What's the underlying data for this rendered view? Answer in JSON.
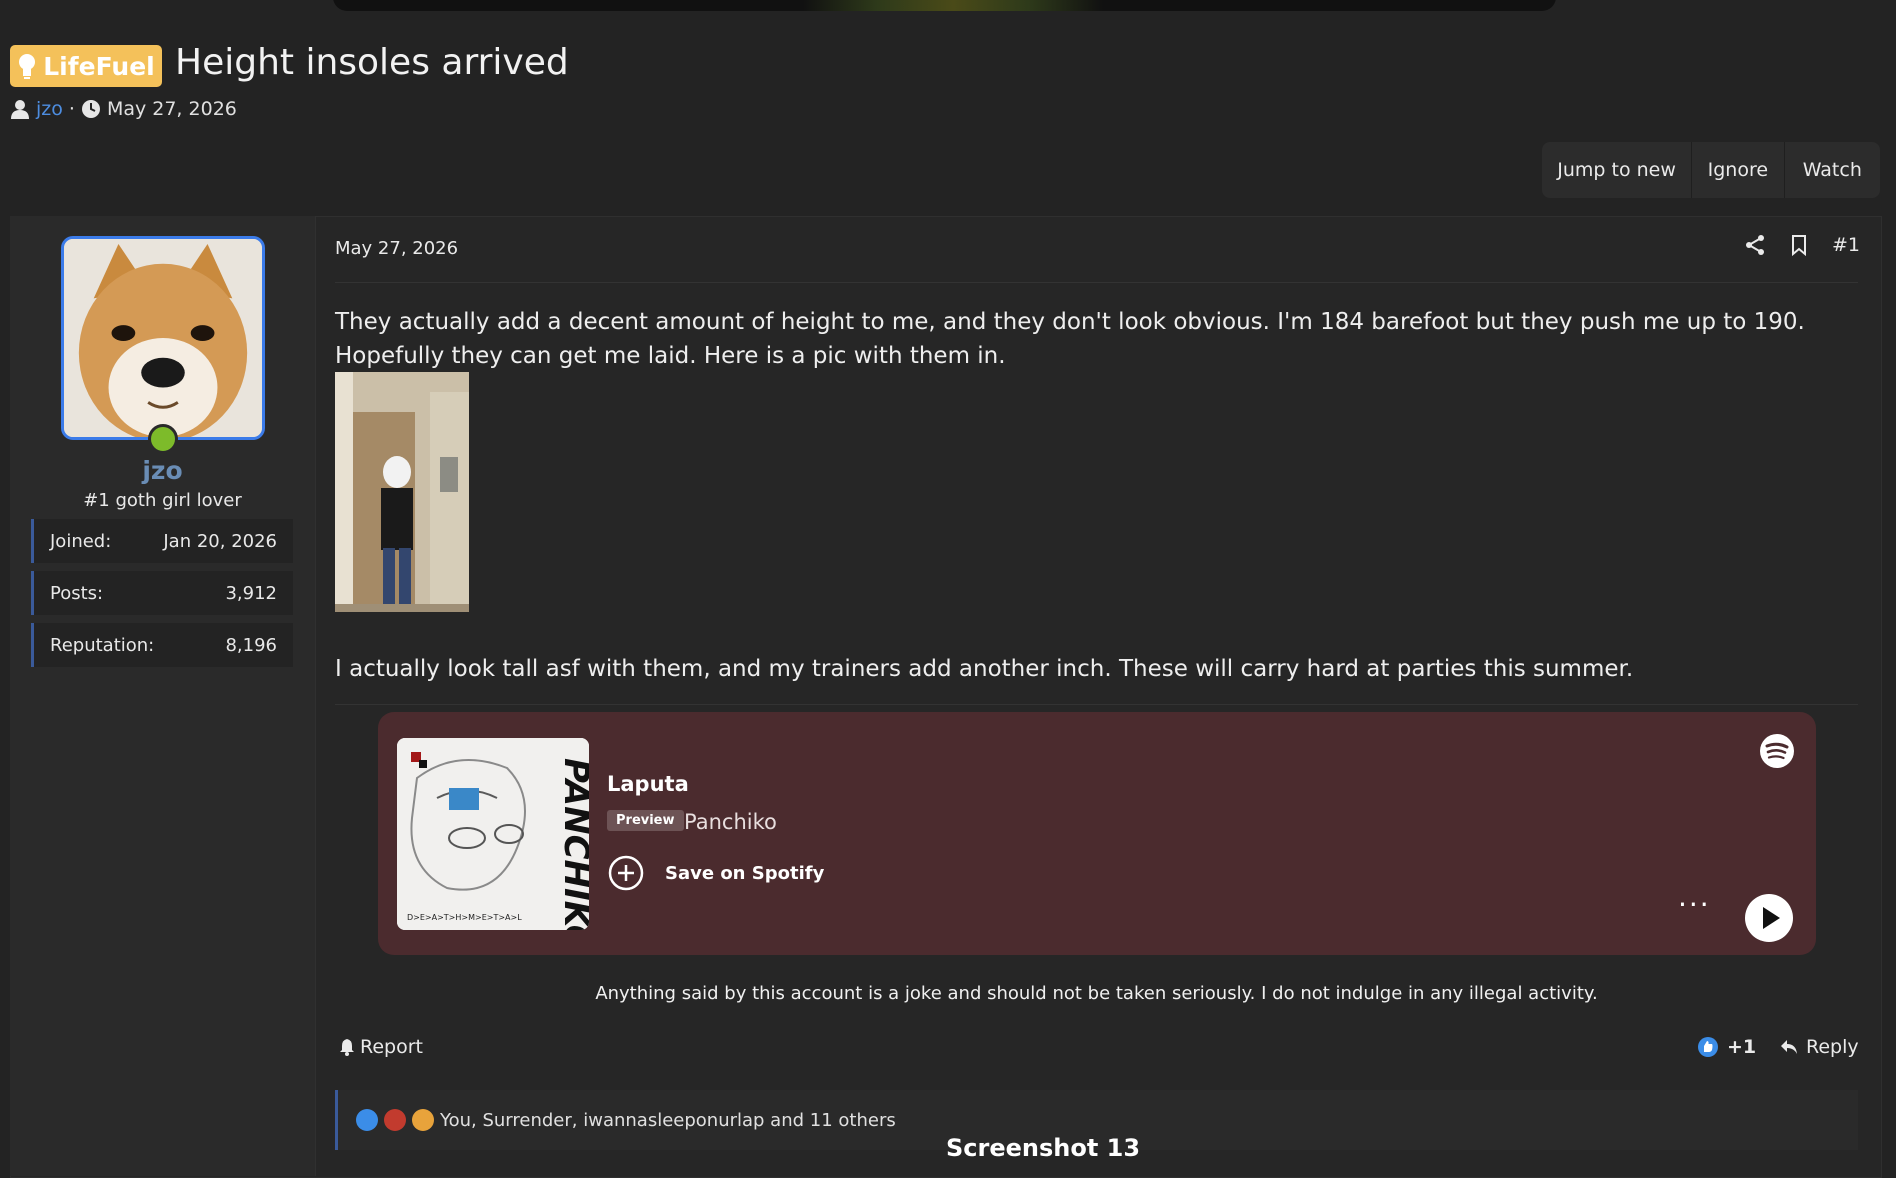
{
  "thread": {
    "prefix": "LifeFuel",
    "title": "Height insoles arrived",
    "author": "jzo",
    "date": "May 27, 2026",
    "actions": {
      "jump": "Jump to new",
      "ignore": "Ignore",
      "watch": "Watch"
    }
  },
  "user": {
    "name": "jzo",
    "title": "#1 goth girl lover",
    "stats": [
      {
        "label": "Joined:",
        "value": "Jan 20, 2026"
      },
      {
        "label": "Posts:",
        "value": "3,912"
      },
      {
        "label": "Reputation:",
        "value": "8,196"
      }
    ]
  },
  "post": {
    "date": "May 27, 2026",
    "number": "#1",
    "text1": "They actually add a decent amount of height to me, and they don't look obvious. I'm 184 barefoot but they push me up to 190. Hopefully they can get me laid. Here is a pic with them in.",
    "text2": "I actually look tall asf with them, and my trainers add another inch. These will carry hard at parties this summer.",
    "signature": "Anything said by this account is a joke and should not be taken seriously. I do not indulge in any illegal activity.",
    "report": "Report",
    "reaction_plus": "+1",
    "reply": "Reply",
    "reactions_summary": "You, Surrender, iwannasleeponurlap and 11 others"
  },
  "spotify": {
    "track": "Laputa",
    "badge": "Preview",
    "artist": "Panchiko",
    "save": "Save on Spotify",
    "more": "···",
    "cover_text": "PANCHIKO",
    "cover_small": "D>E>A>T>H>M>E>T>A>L"
  },
  "caption": "Screenshot 13",
  "colors": {
    "prefix": "#f4c15a",
    "link": "#4d8de0",
    "spotify_bg": "#4b2b2e",
    "online": "#7dbb2a"
  },
  "icons": [
    "lightbulb-icon",
    "user-icon",
    "clock-icon",
    "share-icon",
    "bookmark-icon",
    "bell-icon",
    "like-icon",
    "reply-icon",
    "spotify-icon",
    "plus-circle-icon",
    "play-icon"
  ]
}
